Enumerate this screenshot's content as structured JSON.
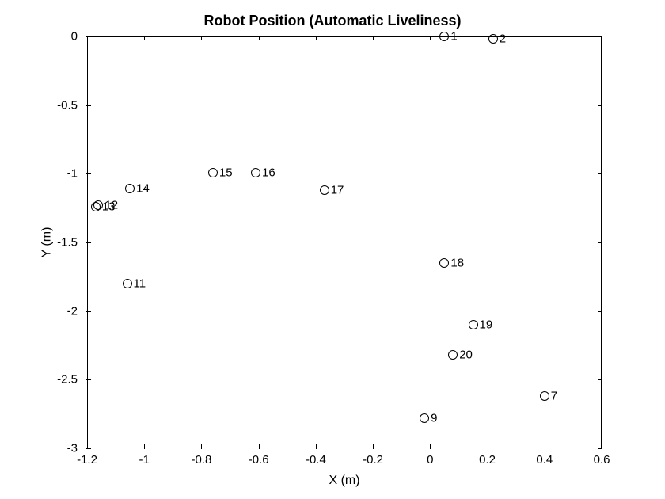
{
  "chart_data": {
    "type": "scatter",
    "title": "Robot Position (Automatic Liveliness)",
    "xlabel": "X (m)",
    "ylabel": "Y (m)",
    "xlim": [
      -1.2,
      0.6
    ],
    "ylim": [
      -3,
      0
    ],
    "xticks": [
      -1.2,
      -1.0,
      -0.8,
      -0.6,
      -0.4,
      -0.2,
      0,
      0.2,
      0.4,
      0.6
    ],
    "yticks": [
      -3,
      -2.5,
      -2,
      -1.5,
      -1,
      -0.5,
      0
    ],
    "xtick_labels": [
      "-1.2",
      "-1",
      "-0.8",
      "-0.6",
      "-0.4",
      "-0.2",
      "0",
      "0.2",
      "0.4",
      "0.6"
    ],
    "ytick_labels": [
      "-3",
      "-2.5",
      "-2",
      "-1.5",
      "-1",
      "-0.5",
      "0"
    ],
    "points": [
      {
        "label": "1",
        "x": 0.05,
        "y": 0.0
      },
      {
        "label": "2",
        "x": 0.22,
        "y": -0.02
      },
      {
        "label": "7",
        "x": 0.4,
        "y": -2.62
      },
      {
        "label": "9",
        "x": -0.02,
        "y": -2.78
      },
      {
        "label": "11",
        "x": -1.06,
        "y": -1.8
      },
      {
        "label": "12",
        "x": -1.16,
        "y": -1.23
      },
      {
        "label": "13",
        "x": -1.17,
        "y": -1.24
      },
      {
        "label": "14",
        "x": -1.05,
        "y": -1.11
      },
      {
        "label": "15",
        "x": -0.76,
        "y": -0.99
      },
      {
        "label": "16",
        "x": -0.61,
        "y": -0.99
      },
      {
        "label": "17",
        "x": -0.37,
        "y": -1.12
      },
      {
        "label": "18",
        "x": 0.05,
        "y": -1.65
      },
      {
        "label": "19",
        "x": 0.15,
        "y": -2.1
      },
      {
        "label": "20",
        "x": 0.08,
        "y": -2.32
      }
    ]
  }
}
